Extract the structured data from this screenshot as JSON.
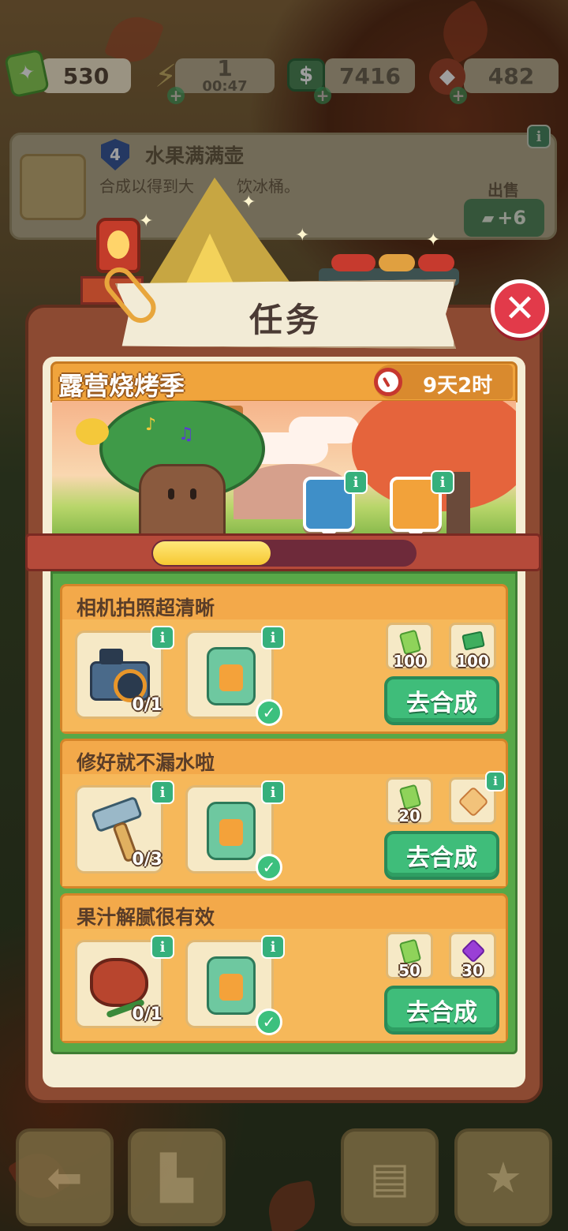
{
  "currencies": {
    "tickets": "530",
    "energy": "1",
    "energy_timer": "00:47",
    "cash": "7416",
    "gems": "482"
  },
  "order_card": {
    "level": "4",
    "title": "水果满满壶",
    "desc_visible": "合成以得到大",
    "desc_end": "饮冰桶。",
    "sell_label": "出售",
    "sell_value": "+6"
  },
  "dialog": {
    "title": "任务",
    "event_name": "露营烧烤季",
    "time_left": "9天2时",
    "progress": 0.45
  },
  "tasks": [
    {
      "title": "相机拍照超清晰",
      "item1": "camera",
      "item1_count": "0/1",
      "item2": "drink-cooler",
      "rewards": [
        {
          "icon": "ticket-icon",
          "value": "100"
        },
        {
          "icon": "cash-icon",
          "value": "100"
        }
      ],
      "button": "去合成"
    },
    {
      "title": "修好就不漏水啦",
      "item1": "hammer",
      "item1_count": "0/3",
      "item2": "drink-cooler",
      "rewards": [
        {
          "icon": "ticket-icon",
          "value": "20"
        },
        {
          "icon": "mystery-box-icon",
          "value": ""
        }
      ],
      "button": "去合成"
    },
    {
      "title": "果汁解腻很有效",
      "item1": "grilled-steak",
      "item1_count": "0/1",
      "item2": "drink-cooler",
      "rewards": [
        {
          "icon": "ticket-icon",
          "value": "50"
        },
        {
          "icon": "gem-icon",
          "value": "30"
        }
      ],
      "button": "去合成"
    }
  ],
  "colors": {
    "close": "#e23a4a",
    "go_button": "#3fbd7a",
    "task_bg": "#f3a94a",
    "progress_fill": "#f6c832"
  }
}
